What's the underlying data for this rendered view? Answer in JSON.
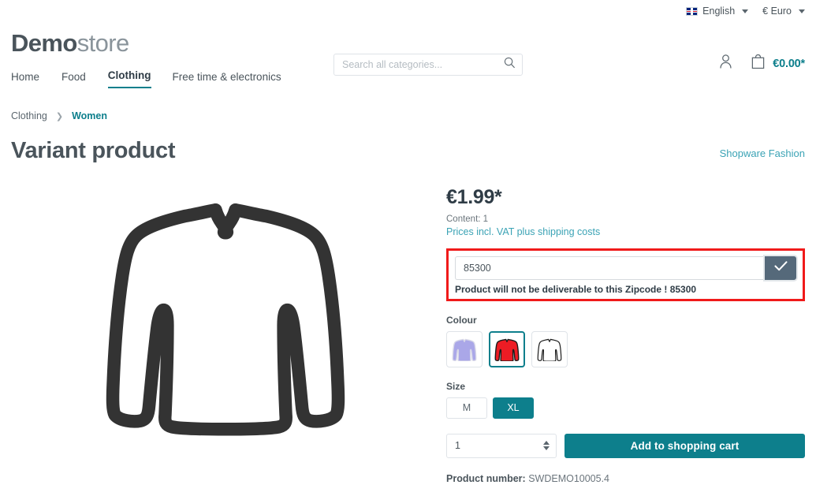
{
  "topbar": {
    "language": {
      "label": "English",
      "icon": "uk-flag-icon"
    },
    "currency": {
      "label": "€ Euro"
    }
  },
  "header": {
    "logo_bold": "Demo",
    "logo_light": "store",
    "search": {
      "value": "",
      "placeholder": "Search all categories..."
    },
    "account_icon": "person-icon",
    "cart_icon": "shopping-bag-icon",
    "cart_total": "€0.00*"
  },
  "nav": {
    "items": [
      {
        "label": "Home",
        "active": false
      },
      {
        "label": "Food",
        "active": false
      },
      {
        "label": "Clothing",
        "active": true
      },
      {
        "label": "Free time & electronics",
        "active": false
      }
    ]
  },
  "breadcrumb": {
    "parent": "Clothing",
    "separator": "❯",
    "current": "Women"
  },
  "product": {
    "title": "Variant product",
    "manufacturer": "Shopware Fashion",
    "image_alt": "long-sleeve-shirt-outline",
    "price": "€1.99*",
    "content_line": "Content: 1",
    "tax_info": "Prices incl. VAT plus shipping costs",
    "product_number_label": "Product number:",
    "product_number_value": "SWDEMO10005.4"
  },
  "zipcode": {
    "value": "85300",
    "placeholder": "",
    "submit_icon": "check-icon",
    "message": "Product will not be deliverable to this Zipcode ! 85300",
    "highlight_color": "#f01a1a"
  },
  "options": {
    "colour": {
      "label": "Colour",
      "values": [
        {
          "name": "purple",
          "swatch": "#aaa7e8",
          "selected": false
        },
        {
          "name": "red",
          "swatch": "#ed1c24",
          "selected": true
        },
        {
          "name": "white",
          "swatch": "#ffffff",
          "selected": false
        }
      ]
    },
    "size": {
      "label": "Size",
      "values": [
        {
          "name": "M",
          "selected": false
        },
        {
          "name": "XL",
          "selected": true
        }
      ]
    }
  },
  "buy": {
    "quantity": "1",
    "add_to_cart_label": "Add to shopping cart"
  },
  "colors": {
    "accent_teal": "#0d7f8c",
    "link_teal": "#3ba3b5",
    "text": "#4a545b",
    "slate_button": "#55697a"
  }
}
